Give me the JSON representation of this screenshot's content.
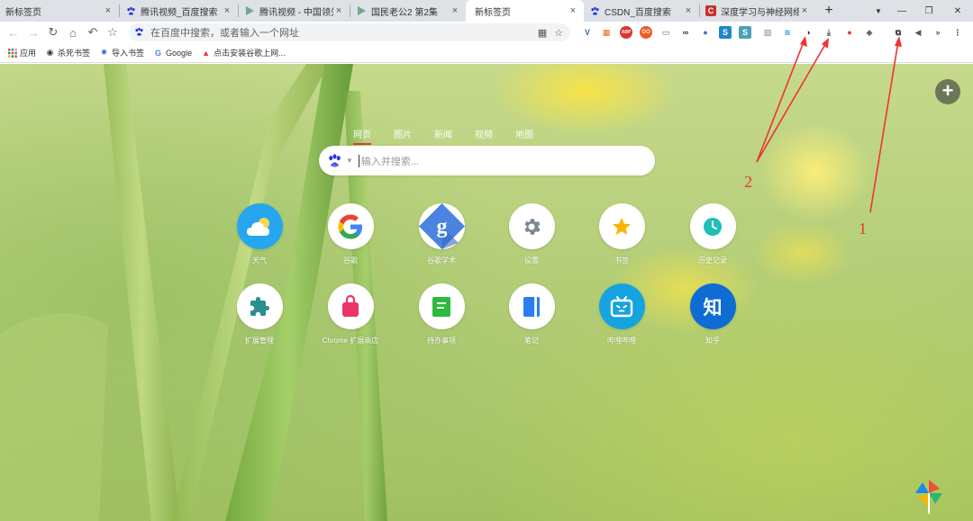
{
  "tabs": [
    {
      "title": "新标签页",
      "icon": "none",
      "close": "×"
    },
    {
      "title": "腾讯视频_百度搜索",
      "icon": "baidu-paw-icon",
      "close": "×"
    },
    {
      "title": "腾讯视频 - 中国领先的",
      "icon": "tencent-video-icon",
      "close": "×"
    },
    {
      "title": "国民老公2 第2集",
      "icon": "tencent-video-icon",
      "close": "×"
    },
    {
      "title": "新标签页",
      "icon": "none",
      "close": "×",
      "active": true
    },
    {
      "title": "CSDN_百度搜索",
      "icon": "baidu-paw-icon",
      "close": "×"
    },
    {
      "title": "深度学习与神经网络学",
      "icon": "csdn-c-icon",
      "close": "×"
    }
  ],
  "tabstrip": {
    "new_tab": "+",
    "tab_search": "▼",
    "minimize": "—",
    "restore": "❐",
    "close": "✕"
  },
  "toolbar": {
    "back": "←",
    "forward": "→",
    "reload": "↻",
    "home": "⌂",
    "undo": "↶",
    "star": "☆",
    "omnibox_placeholder": "在百度中搜索，或者输入一个网址",
    "qr": "▦",
    "omni_star": "☆"
  },
  "extensions": [
    "V",
    "▦",
    "ABP",
    "OO",
    "▭",
    "∞",
    "●",
    "S",
    "S",
    "▨",
    "≋",
    "◑",
    "⤓",
    "●",
    "◆",
    "⧉",
    "◀",
    "»",
    "⋮"
  ],
  "bookmarks": [
    {
      "label": "应用",
      "icon": "apps-grid-icon"
    },
    {
      "label": "杀死书签",
      "icon": "gear-globe-icon"
    },
    {
      "label": "导入书签",
      "icon": "gear-icon"
    },
    {
      "label": "Google",
      "icon": "google-g-icon"
    },
    {
      "label": "点击安装谷歌上网...",
      "icon": "rocket-icon"
    }
  ],
  "search": {
    "tabs": [
      "网页",
      "图片",
      "新闻",
      "视频",
      "地图"
    ],
    "active_tab": "网页",
    "placeholder": "输入并搜索...",
    "engine_caret": "▼"
  },
  "apps": [
    {
      "label": "天气",
      "icon": "weather-cloud-icon"
    },
    {
      "label": "谷歌",
      "icon": "google-icon"
    },
    {
      "label": "谷歌学术",
      "icon": "google-scholar-icon"
    },
    {
      "label": "设置",
      "icon": "gear-icon"
    },
    {
      "label": "书签",
      "icon": "star-icon"
    },
    {
      "label": "历史记录",
      "icon": "clock-icon"
    },
    {
      "label": "扩展管理",
      "icon": "puzzle-icon"
    },
    {
      "label": "Chrome 扩展商店",
      "icon": "shopping-bag-icon"
    },
    {
      "label": "待办事项",
      "icon": "todo-note-icon"
    },
    {
      "label": "笔记",
      "icon": "notebook-icon"
    },
    {
      "label": "哔哩哔哩",
      "icon": "bilibili-tv-icon"
    },
    {
      "label": "知乎",
      "icon": "zhihu-icon",
      "glyph": "知"
    }
  ],
  "add_button": "+",
  "annotations": [
    "2",
    "1"
  ],
  "colors": {
    "baidu_blue": "#2932e1",
    "accent_red": "#e13a3a",
    "arrow_red": "#ee3333"
  }
}
